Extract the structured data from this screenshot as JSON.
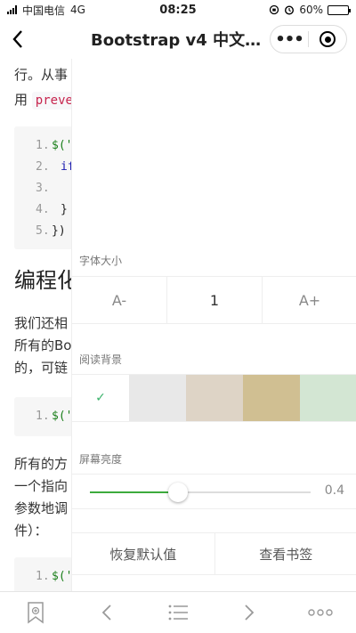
{
  "status_bar": {
    "carrier": "中国电信",
    "network": "4G",
    "time": "08:25",
    "battery": "60%",
    "battery_level": 0.6
  },
  "nav": {
    "title": "Bootstrap v4 中文…",
    "more_glyph": "•••"
  },
  "article": {
    "para1_line1": "行。从事",
    "para1_line2_prefix": "用",
    "para1_code": "preve",
    "code1": [
      {
        "num": "1.",
        "text": "$('"
      },
      {
        "num": "2.",
        "text": "if"
      },
      {
        "num": "3.",
        "text": ""
      },
      {
        "num": "4.",
        "text": "}"
      },
      {
        "num": "5.",
        "text": "})"
      }
    ],
    "heading": "编程化",
    "para2": [
      "我们还相",
      "所有的Bo",
      "的，可链"
    ],
    "code2": [
      {
        "num": "1.",
        "text": "$('"
      }
    ],
    "para3": [
      "所有的方",
      "一个指向",
      "参数地调",
      "件）："
    ],
    "code3": [
      {
        "num": "1.",
        "text": "$('"
      }
    ]
  },
  "settings": {
    "font_size_label": "字体大小",
    "font_decrease": "A-",
    "font_value": "1",
    "font_increase": "A+",
    "background_label": "阅读背景",
    "selected_check": "✓",
    "swatch_colors": [
      "#ffffff",
      "#e8e8e8",
      "#ded4c6",
      "#d0bf92",
      "#d3e6d3"
    ],
    "brightness_label": "屏幕亮度",
    "brightness_value": "0.4",
    "brightness_level": 0.4,
    "reset_label": "恢复默认值",
    "bookmarks_label": "查看书签"
  },
  "toolbar": {
    "icons": [
      "bookmark-add-icon",
      "chevron-left-icon",
      "list-icon",
      "chevron-right-icon",
      "more-icon"
    ]
  },
  "colors": {
    "accent_green": "#3dab3d",
    "code_red": "#c7254e"
  }
}
